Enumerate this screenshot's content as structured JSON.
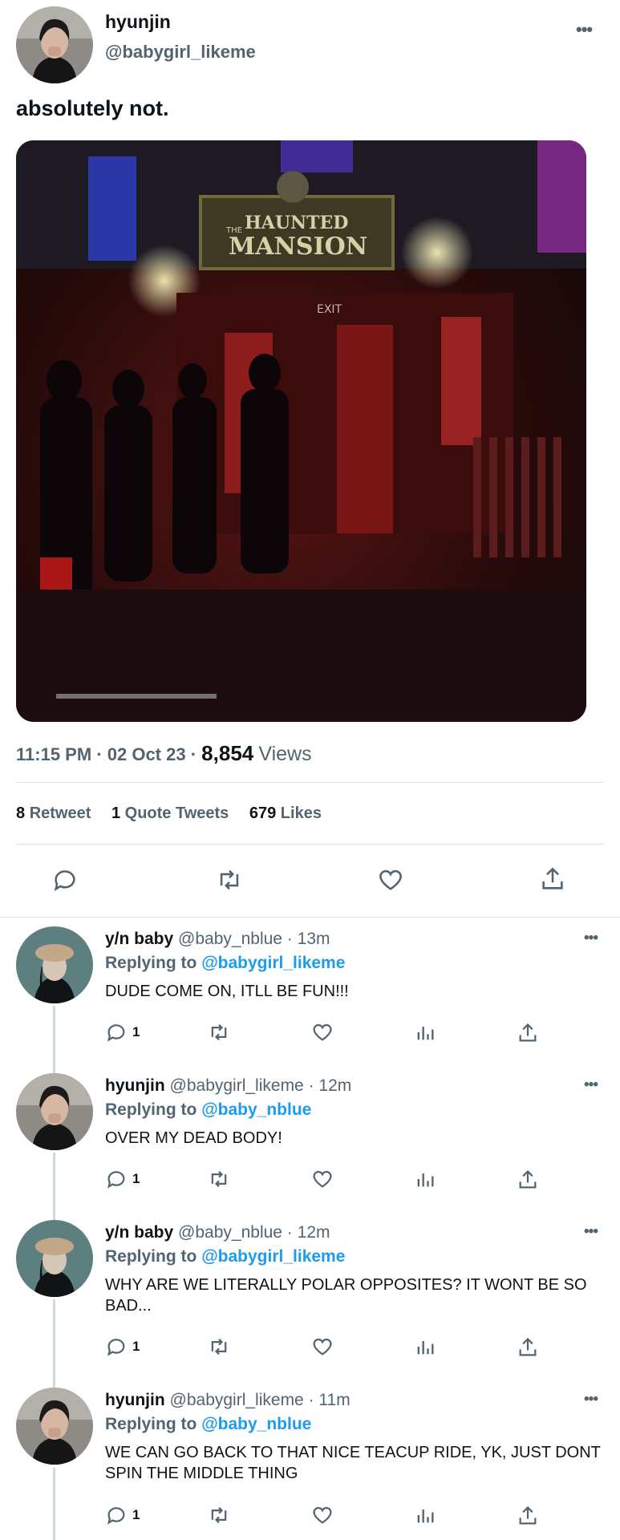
{
  "tweet": {
    "name": "hyunjin",
    "handle": "@babygirl_likeme",
    "more_icon": "more-horizontal-icon",
    "text": "absolutely not.",
    "image_sign_small": "THE",
    "image_sign_big1": "HAUNTED",
    "image_sign_big2": "MANSION",
    "image_exit": "EXIT",
    "time": "11:15 PM",
    "date": "02 Oct 23",
    "views_count": "8,854",
    "views_label": "Views",
    "retweets_count": "8",
    "retweets_label": "Retweet",
    "quotes_count": "1",
    "quotes_label": "Quote Tweets",
    "likes_count": "679",
    "likes_label": "Likes",
    "actions": [
      "reply-icon",
      "retweet-icon",
      "like-icon",
      "share-icon"
    ]
  },
  "replies": [
    {
      "name": "y/n baby",
      "handle": "@baby_nblue",
      "time": "13m",
      "replying_label": "Replying to",
      "replying_to": "@babygirl_likeme",
      "text": "DUDE COME ON, ITLL BE FUN!!!",
      "reply_count": "1"
    },
    {
      "name": "hyunjin",
      "handle": "@babygirl_likeme",
      "time": "12m",
      "replying_label": "Replying to",
      "replying_to": "@baby_nblue",
      "text": "OVER MY DEAD BODY!",
      "reply_count": "1"
    },
    {
      "name": "y/n baby",
      "handle": "@baby_nblue",
      "time": "12m",
      "replying_label": "Replying to",
      "replying_to": "@babygirl_likeme",
      "text": "WHY ARE WE LITERALLY POLAR OPPOSITES? IT WONT BE SO BAD...",
      "reply_count": "1"
    },
    {
      "name": "hyunjin",
      "handle": "@babygirl_likeme",
      "time": "11m",
      "replying_label": "Replying to",
      "replying_to": "@baby_nblue",
      "text": "WE CAN GO BACK TO THAT NICE TEACUP RIDE, YK, JUST DONT SPIN THE MIDDLE THING",
      "reply_count": "1"
    }
  ],
  "colors": {
    "accent": "#1d9bf0",
    "secondary_text": "#536471",
    "primary_text": "#0f1419"
  }
}
